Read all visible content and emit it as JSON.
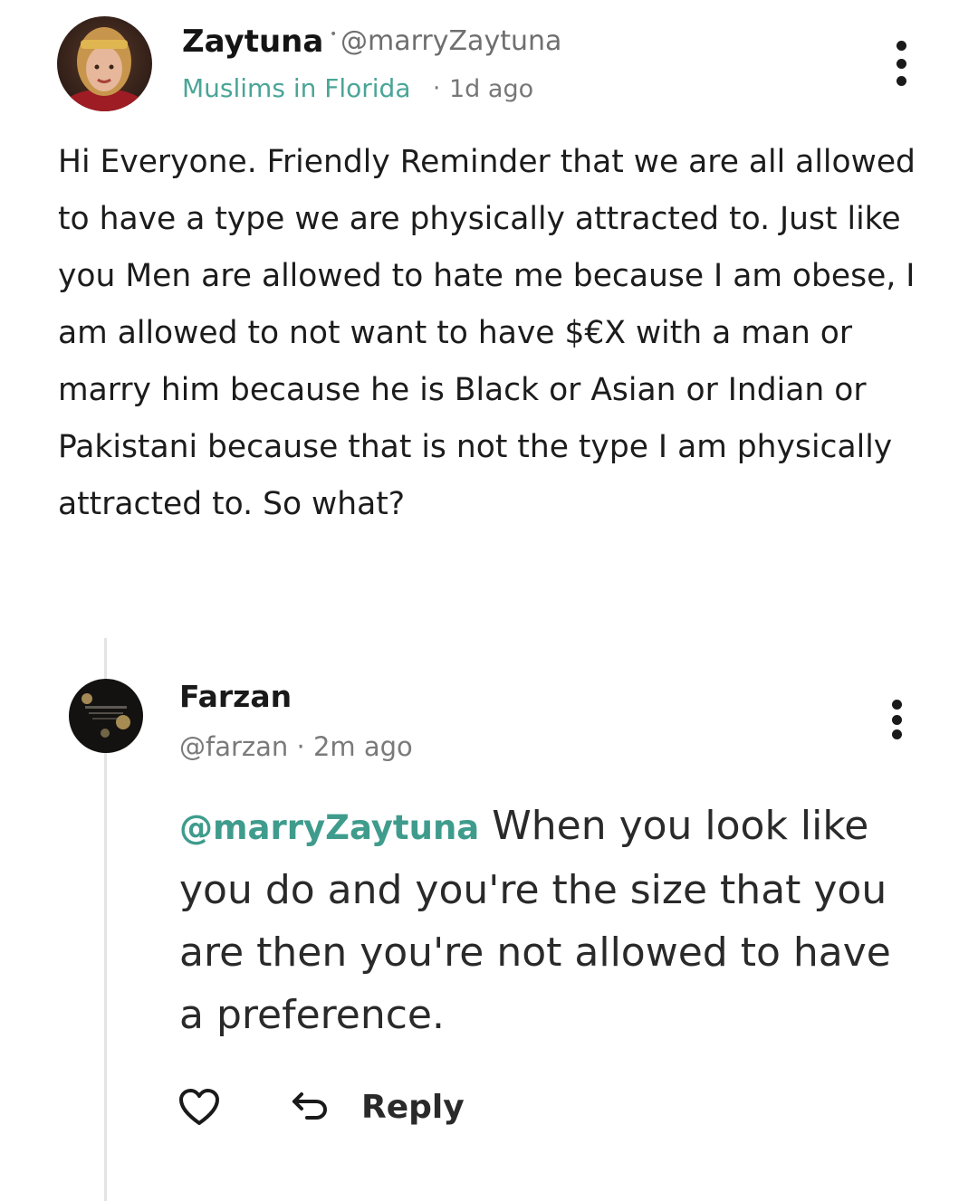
{
  "post": {
    "author_name": "Zaytuna",
    "author_handle": "@marryZaytuna",
    "community": "Muslims in Florida",
    "time_sep": "·",
    "time_ago": "1d ago",
    "body": "Hi Everyone. Friendly Reminder that we are all allowed to have a type we are physically attracted to. Just like you Men are allowed to hate me because I am obese, I am allowed to not want to have $€X with a man or marry him because he is Black or Asian or Indian or Pakistani because that is not the type I am physically attracted to. So what?"
  },
  "reply": {
    "author_name": "Farzan",
    "author_handle": "@farzan",
    "time_sep": "·",
    "time_ago": "2m ago",
    "mention": "@marryZaytuna",
    "body": " When you look like you do and you're the size that you are then you're not allowed to have a preference.",
    "reply_label": "Reply"
  },
  "icons": {
    "like": "heart-icon",
    "reply": "reply-arrow-icon",
    "more": "more-vertical-icon"
  },
  "colors": {
    "accent": "#4aa597",
    "mention": "#3f9c8d",
    "muted": "#777777"
  }
}
